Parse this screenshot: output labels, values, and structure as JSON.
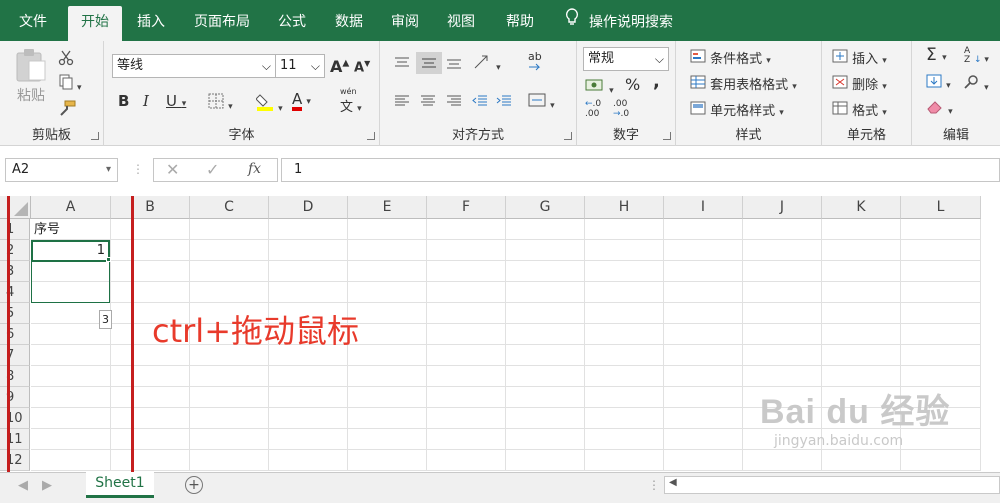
{
  "tabs": [
    "文件",
    "开始",
    "插入",
    "页面布局",
    "公式",
    "数据",
    "审阅",
    "视图",
    "帮助"
  ],
  "tell_me": "操作说明搜索",
  "clipboard": {
    "paste": "粘贴",
    "label": "剪贴板"
  },
  "font": {
    "name": "等线",
    "size": "11",
    "grow": "A",
    "shrink": "A",
    "bold": "B",
    "italic": "I",
    "underline": "U",
    "font_color": "A",
    "phonetic": "文",
    "phonetic_top": "wén",
    "label": "字体"
  },
  "align": {
    "wrap": "ab",
    "label": "对齐方式"
  },
  "number": {
    "format": "常规",
    "percent": "%",
    "comma": ",",
    "inc_top": ".0",
    "inc_bottom": ".00",
    "dec_top": ".00",
    "dec_bottom": ".0",
    "label": "数字"
  },
  "styles": {
    "conditional": "条件格式",
    "table": "套用表格格式",
    "cell": "单元格样式",
    "label": "样式"
  },
  "cells": {
    "insert": "插入",
    "delete": "删除",
    "format": "格式",
    "label": "单元格"
  },
  "editing": {
    "sum": "Σ",
    "sort": "AZ",
    "label": "编辑"
  },
  "formula_bar": {
    "name_box": "A2",
    "fx": "fx",
    "value": "1"
  },
  "columns": [
    "A",
    "B",
    "C",
    "D",
    "E",
    "F",
    "G",
    "H",
    "I",
    "J",
    "K",
    "L"
  ],
  "rows": [
    "1",
    "2",
    "3",
    "4",
    "5",
    "6",
    "7",
    "8",
    "9",
    "10",
    "11",
    "12"
  ],
  "cells_data": {
    "a1": "序号",
    "a2": "1"
  },
  "autofill_tip": "3",
  "annotation": "ctrl+拖动鼠标",
  "sheet_tab": "Sheet1",
  "watermark": {
    "brand": "Bai du 经验",
    "url": "jingyan.baidu.com"
  },
  "colors": {
    "excel_green": "#217346",
    "annotation_red": "#e83a2b",
    "select_green": "#1e7145"
  }
}
